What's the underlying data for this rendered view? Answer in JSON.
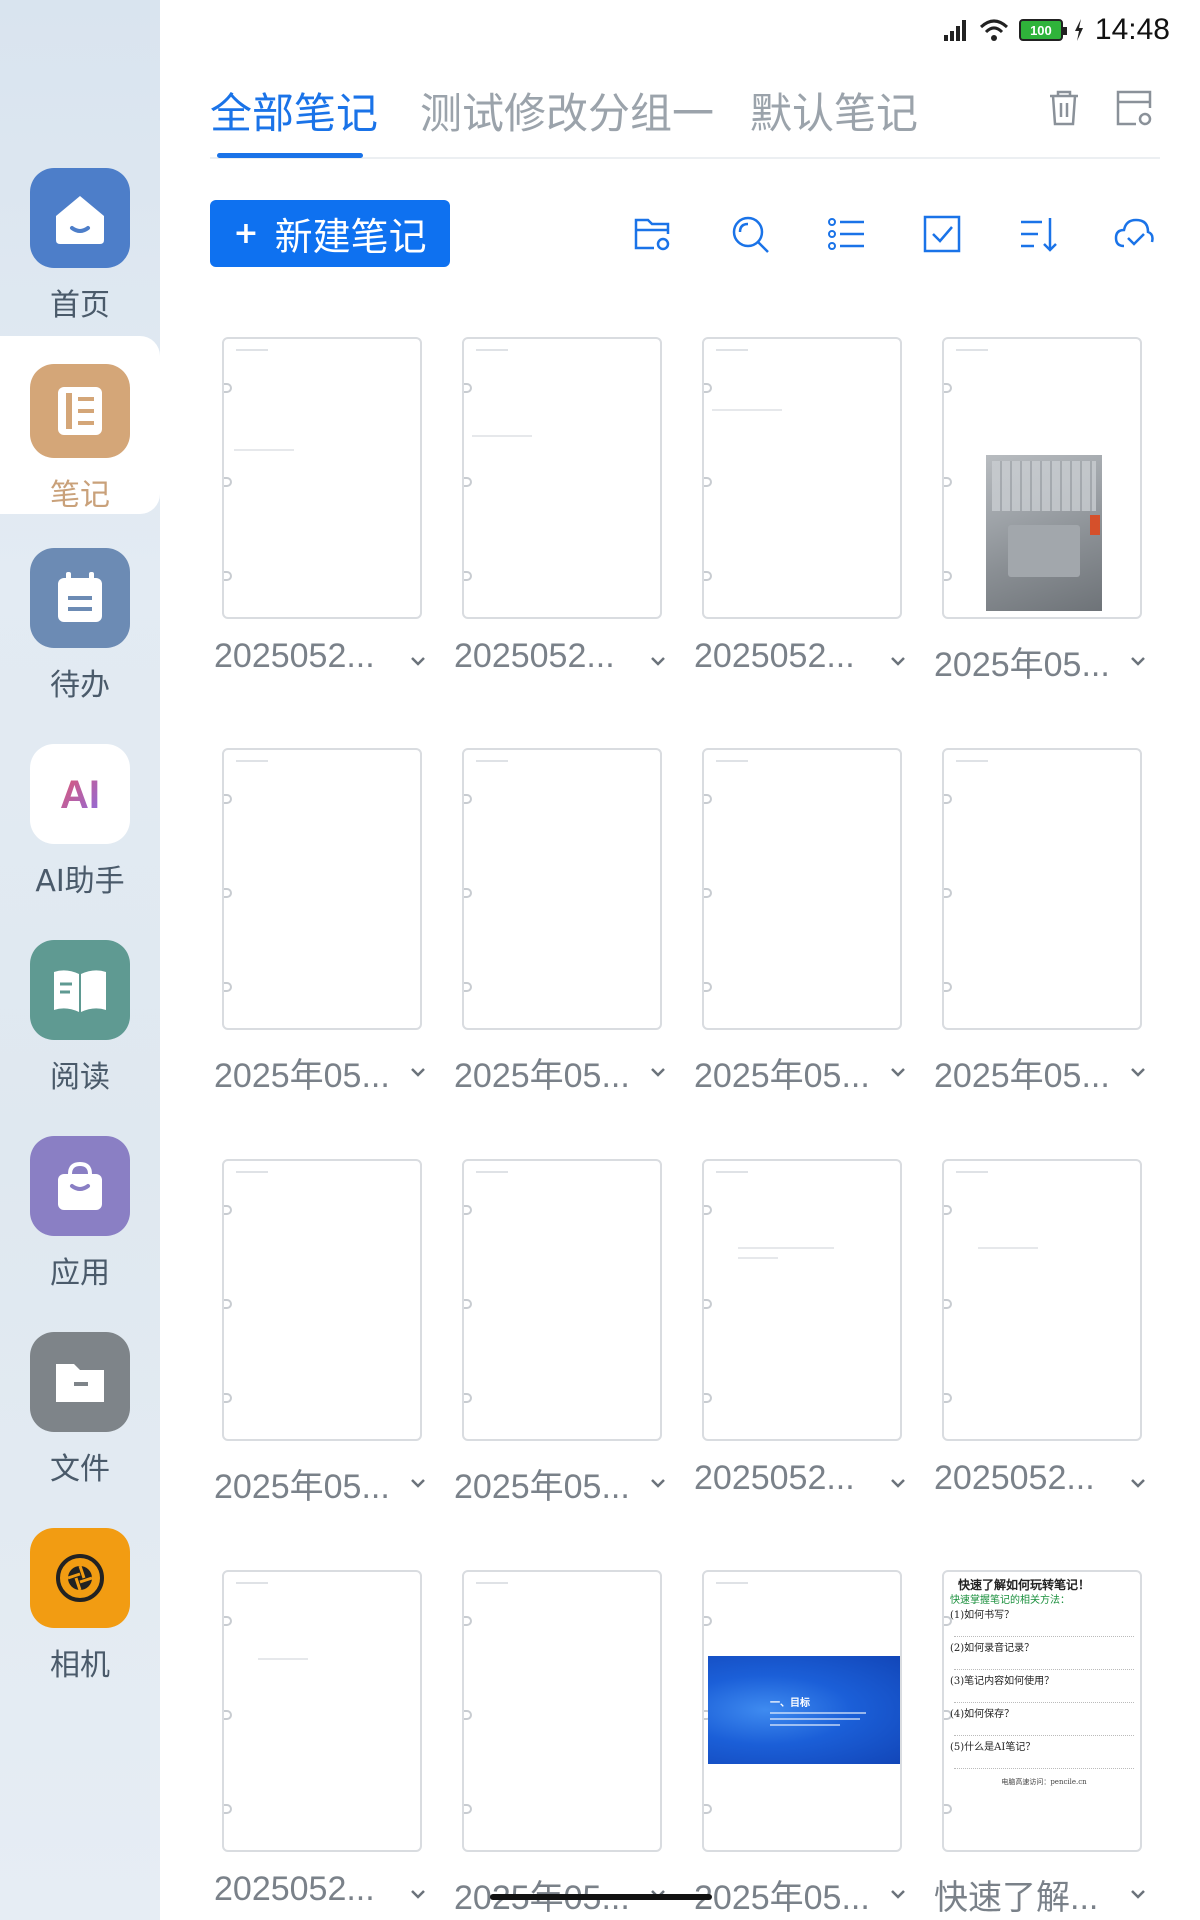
{
  "status_bar": {
    "battery": "100",
    "time": "14:48"
  },
  "sidebar": {
    "items": [
      {
        "label": "首页",
        "icon": "home-icon",
        "color": "#4d7ec9"
      },
      {
        "label": "笔记",
        "icon": "notebook-icon",
        "color": "#d4a678",
        "active": true
      },
      {
        "label": "待办",
        "icon": "todo-icon",
        "color": "#6c8bb4"
      },
      {
        "label": "AI助手",
        "icon": "ai-assistant-icon",
        "color": "#ffffff"
      },
      {
        "label": "阅读",
        "icon": "reading-icon",
        "color": "#5f9a92"
      },
      {
        "label": "应用",
        "icon": "apps-bag-icon",
        "color": "#8a7fc4"
      },
      {
        "label": "文件",
        "icon": "folder-icon",
        "color": "#7e8489"
      },
      {
        "label": "相机",
        "icon": "camera-icon",
        "color": "#f29c12"
      }
    ]
  },
  "tabs": [
    {
      "label": "全部笔记",
      "active": true
    },
    {
      "label": "测试修改分组一"
    },
    {
      "label": "默认笔记"
    }
  ],
  "toolbar": {
    "new_note_plus": "+",
    "new_note_label": "新建笔记",
    "icons": [
      "folder-settings-icon",
      "search-icon",
      "list-view-icon",
      "select-checkbox-icon",
      "sort-icon",
      "cloud-sync-icon"
    ]
  },
  "notes": [
    {
      "title": "2025052..."
    },
    {
      "title": "2025052..."
    },
    {
      "title": "2025052..."
    },
    {
      "title": "2025年05...",
      "thumb": "photo"
    },
    {
      "title": "2025年05..."
    },
    {
      "title": "2025年05..."
    },
    {
      "title": "2025年05..."
    },
    {
      "title": "2025年05..."
    },
    {
      "title": "2025年05..."
    },
    {
      "title": "2025年05..."
    },
    {
      "title": "2025052..."
    },
    {
      "title": "2025052..."
    },
    {
      "title": "2025052..."
    },
    {
      "title": "2025年05..."
    },
    {
      "title": "2025年05...",
      "thumb": "slide",
      "slide_title": "一、目标"
    },
    {
      "title": "快速了解...",
      "thumb": "handwriting"
    }
  ],
  "handwriting_note": {
    "title": "快速了解如何玩转笔记！",
    "green_line": "快速掌握笔记的相关方法：",
    "lines": [
      "(1)如何书写？",
      "(2)如何录音记录？",
      "(3)笔记内容如何使用？",
      "(4)如何保存？",
      "(5)什么是AI笔记？"
    ],
    "footer": "电脑高速访问：pencile.cn"
  },
  "colors": {
    "accent": "#1a73e8",
    "primary_button": "#0e71f0",
    "inactive_tab": "#9ba3ab"
  }
}
